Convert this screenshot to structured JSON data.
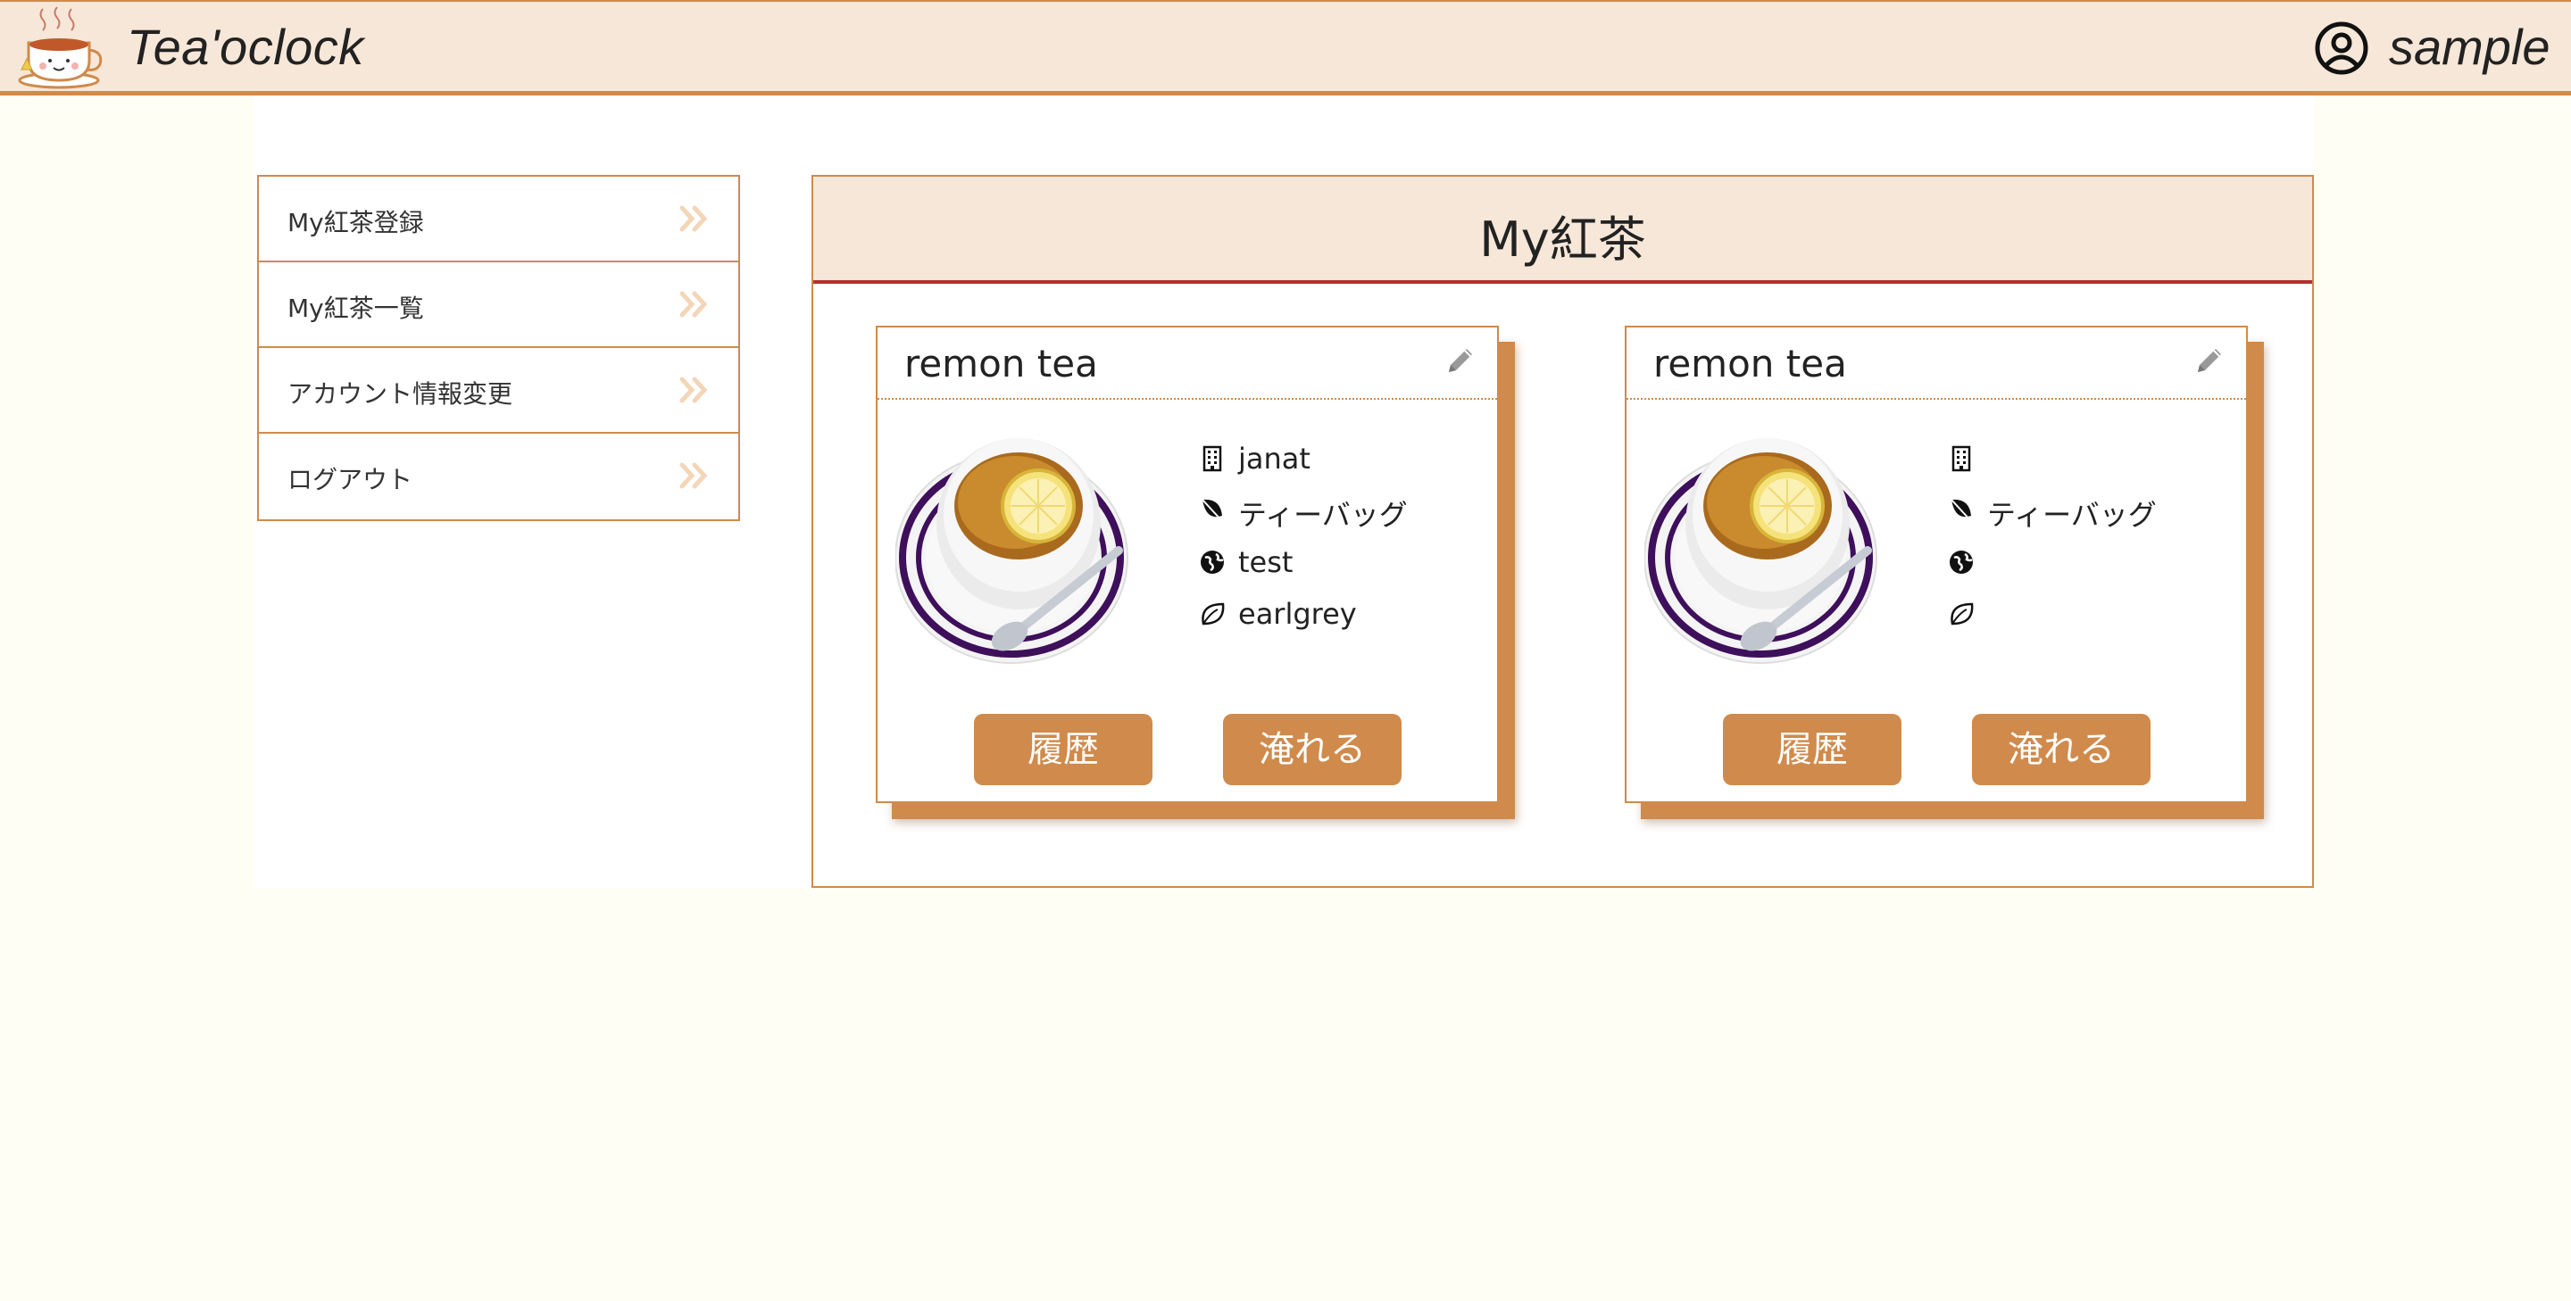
{
  "header": {
    "brand": "Tea'oclock",
    "username": "sample",
    "logo_icon": "teacup-logo-icon",
    "user_icon": "user-circle-icon"
  },
  "sidebar": {
    "items": [
      {
        "label": "My紅茶登録",
        "icon": "chevron-double-right-icon"
      },
      {
        "label": "My紅茶一覧",
        "icon": "chevron-double-right-icon"
      },
      {
        "label": "アカウント情報変更",
        "icon": "chevron-double-right-icon"
      },
      {
        "label": "ログアウト",
        "icon": "chevron-double-right-icon"
      }
    ]
  },
  "main": {
    "title": "My紅茶",
    "cards": [
      {
        "name": "remon tea",
        "brand": "janat",
        "type": "ティーバッグ",
        "origin": "test",
        "leaf": "earlgrey",
        "history_label": "履歴",
        "brew_label": "淹れる"
      },
      {
        "name": "remon tea",
        "brand": "",
        "type": "ティーバッグ",
        "origin": "",
        "leaf": "",
        "history_label": "履歴",
        "brew_label": "淹れる"
      }
    ]
  },
  "colors": {
    "accent": "#cf8a4c",
    "header_bg": "#f6e7d8",
    "page_bg": "#fffef5",
    "title_underline": "#b4302b"
  }
}
